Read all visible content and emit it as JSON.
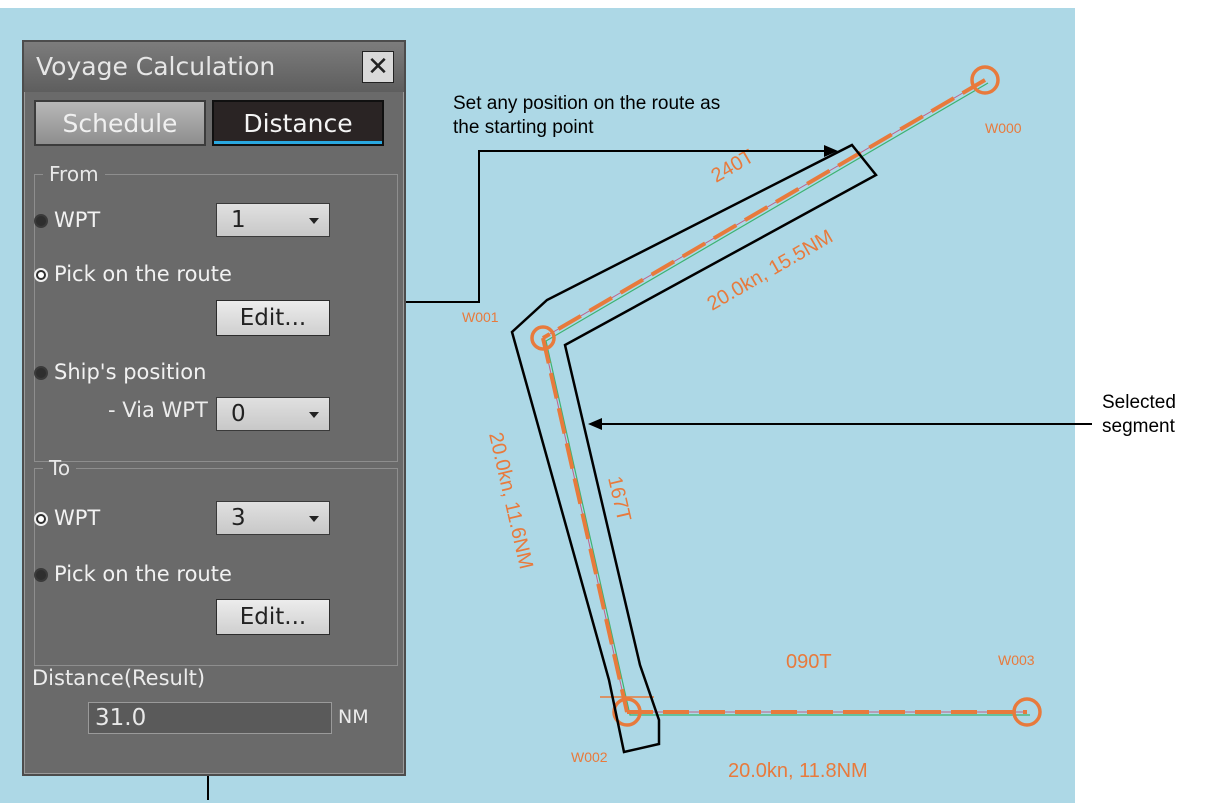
{
  "window": {
    "title": "Voyage Calculation",
    "tabs": [
      {
        "label": "Schedule"
      },
      {
        "label": "Distance"
      }
    ],
    "active_tab": "Distance"
  },
  "from_group": {
    "legend": "From",
    "wpt_label": "WPT",
    "wpt_value": "1",
    "pick_label": "Pick on the route",
    "pick_button": "Edit...",
    "ship_label": "Ship's position",
    "via_wpt_label": "- Via WPT",
    "via_wpt_value": "0",
    "selected": "pick"
  },
  "to_group": {
    "legend": "To",
    "wpt_label": "WPT",
    "wpt_value": "3",
    "pick_label": "Pick on the route",
    "pick_button": "Edit...",
    "selected": "wpt"
  },
  "result": {
    "label": "Distance(Result)",
    "value": "31.0",
    "unit": "NM"
  },
  "route": {
    "color": "#e87a3c",
    "chart_bg": "#add8e6",
    "waypoints": [
      {
        "name": "W000"
      },
      {
        "name": "W001"
      },
      {
        "name": "W002"
      },
      {
        "name": "W003"
      }
    ],
    "legs": [
      {
        "course": "240T",
        "info": "20.0kn, 15.5NM"
      },
      {
        "course": "167T",
        "info": "20.0kn, 11.6NM"
      },
      {
        "course": "090T",
        "info": "20.0kn, 11.8NM"
      }
    ]
  },
  "annotations": {
    "start_point": "Set any position on the route as the starting point",
    "start_point_line1": "Set any position on the route as",
    "start_point_line2": "the starting point",
    "selected_segment_line1": "Selected",
    "selected_segment_line2": "segment"
  }
}
